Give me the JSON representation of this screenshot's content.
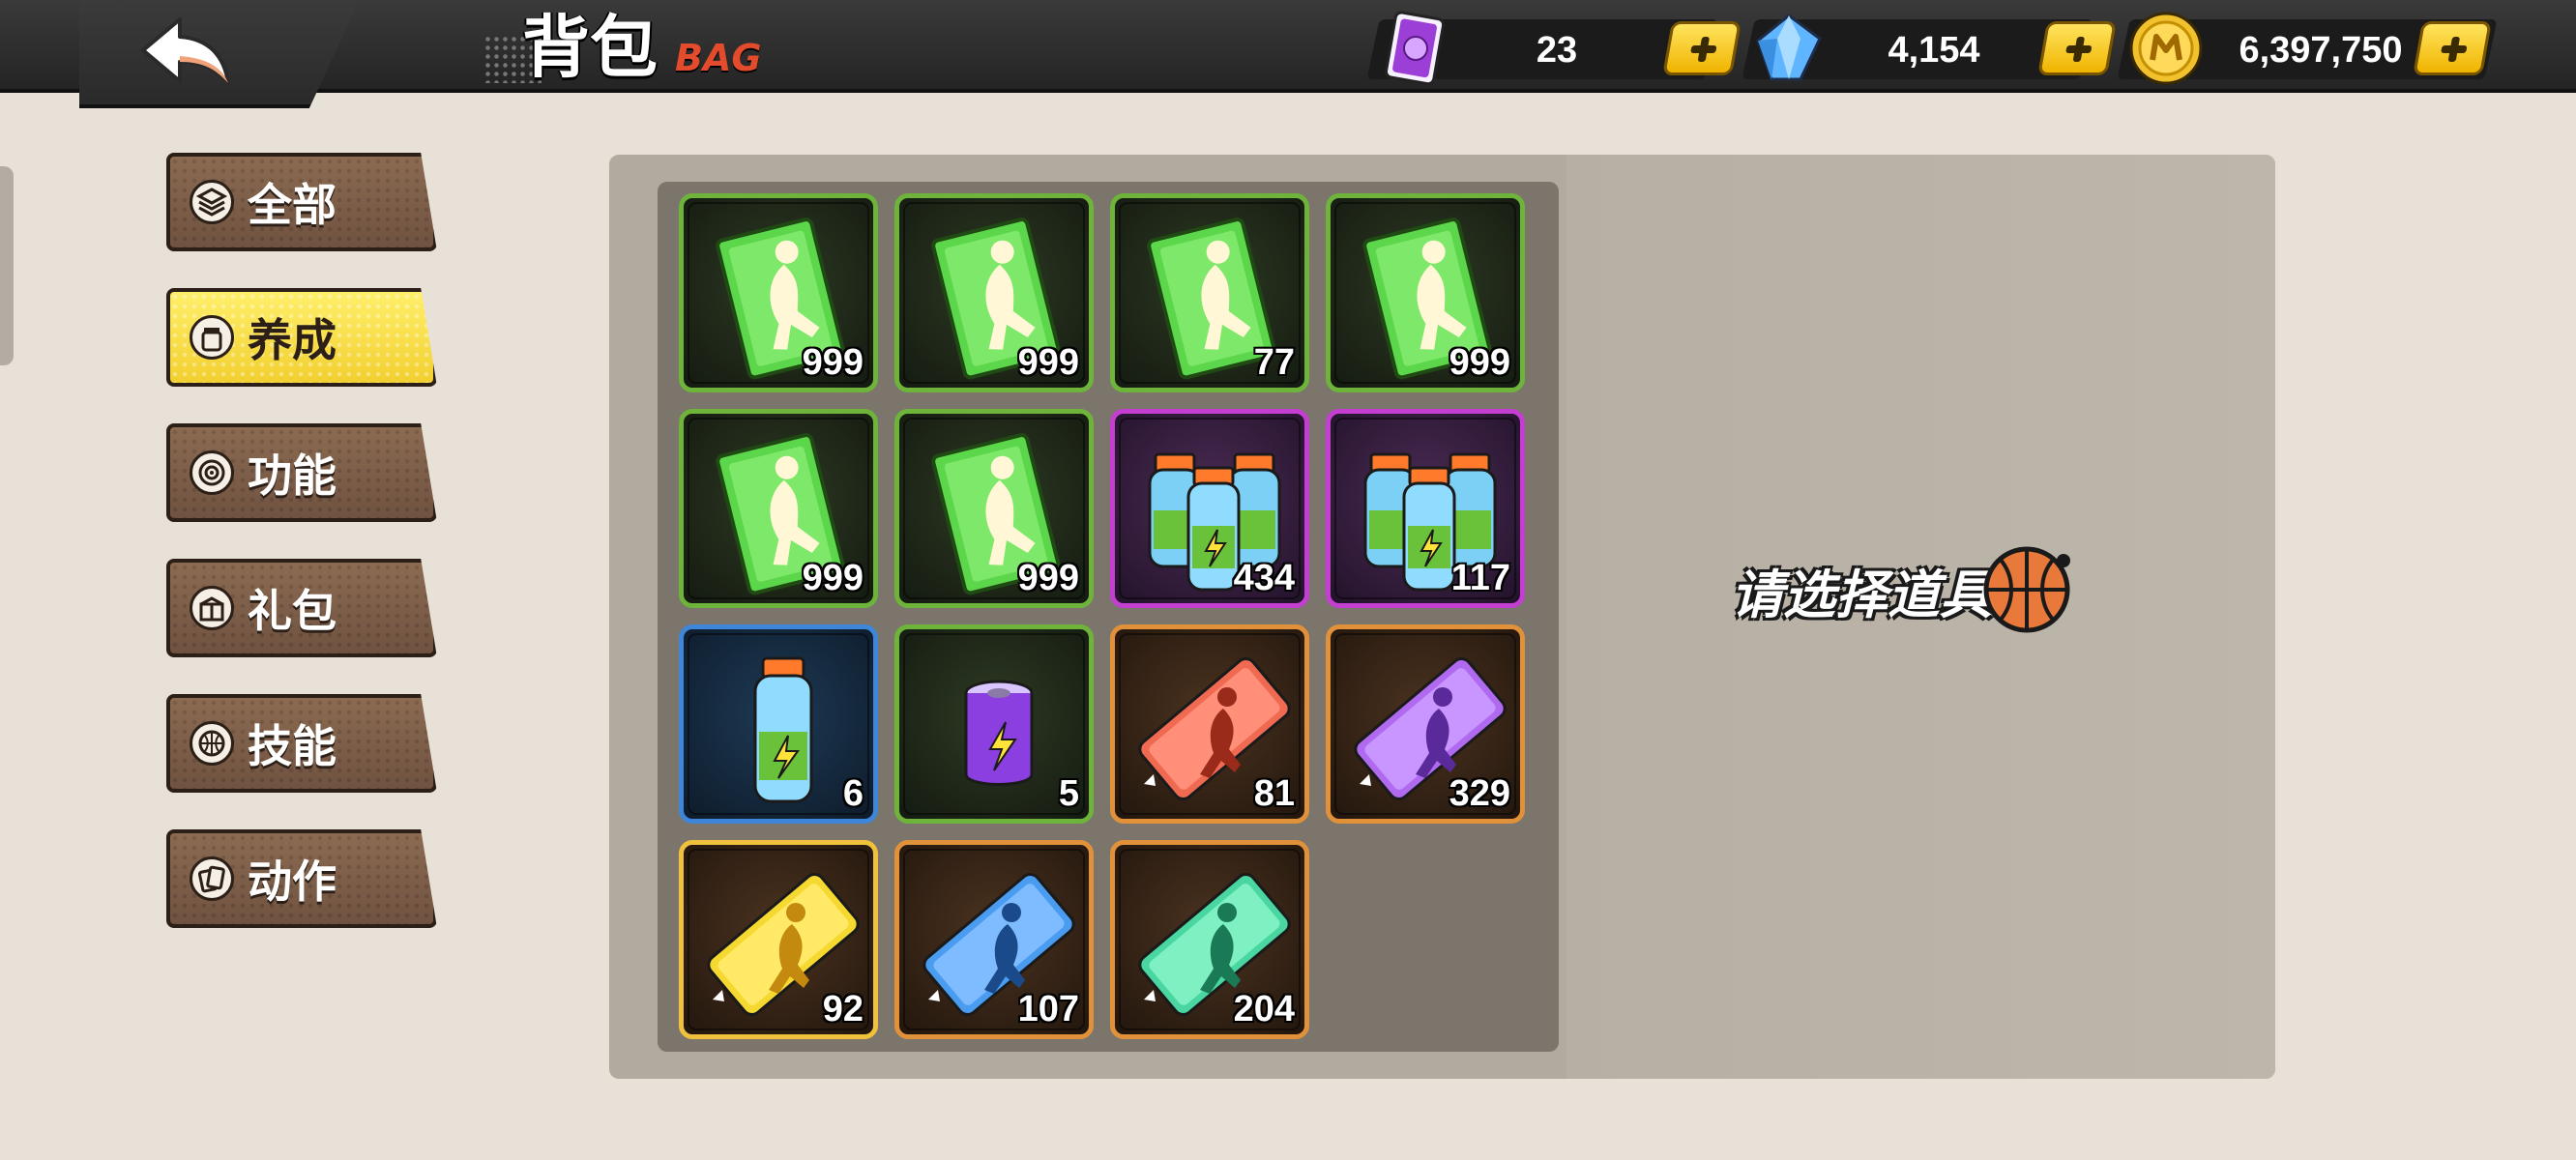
{
  "header": {
    "title_cn": "背包",
    "title_en": "BAG"
  },
  "currencies": [
    {
      "name": "card",
      "icon": "purple-card-icon",
      "value": "23"
    },
    {
      "name": "diamond",
      "icon": "diamond-icon",
      "value": "4,154"
    },
    {
      "name": "coin",
      "icon": "gold-coin-icon",
      "value": "6,397,750"
    }
  ],
  "tabs": [
    {
      "label": "全部",
      "icon": "layers-icon",
      "active": false
    },
    {
      "label": "养成",
      "icon": "jar-icon",
      "active": true
    },
    {
      "label": "功能",
      "icon": "target-icon",
      "active": false
    },
    {
      "label": "礼包",
      "icon": "gift-icon",
      "active": false
    },
    {
      "label": "技能",
      "icon": "basketball-icon",
      "active": false
    },
    {
      "label": "动作",
      "icon": "cards-icon",
      "active": false
    }
  ],
  "items": [
    {
      "qty": "999",
      "kind": "green-dunk-card-icon",
      "rarity": "green"
    },
    {
      "qty": "999",
      "kind": "green-dunk-card-icon",
      "rarity": "green"
    },
    {
      "qty": "77",
      "kind": "green-dunk-card-icon",
      "rarity": "green"
    },
    {
      "qty": "999",
      "kind": "green-dunk-card-icon",
      "rarity": "green"
    },
    {
      "qty": "999",
      "kind": "green-dunk-card-icon",
      "rarity": "green"
    },
    {
      "qty": "999",
      "kind": "green-dunk-card-icon",
      "rarity": "green"
    },
    {
      "qty": "434",
      "kind": "energy-drink-pack-icon",
      "rarity": "purple"
    },
    {
      "qty": "117",
      "kind": "energy-drink-pack-icon",
      "rarity": "purple"
    },
    {
      "qty": "6",
      "kind": "energy-drink-bottle-icon",
      "rarity": "blue"
    },
    {
      "qty": "5",
      "kind": "energy-can-icon",
      "rarity": "green"
    },
    {
      "qty": "81",
      "kind": "red-player-ticket-icon",
      "rarity": "orange"
    },
    {
      "qty": "329",
      "kind": "purple-player-ticket-icon",
      "rarity": "orange"
    },
    {
      "qty": "92",
      "kind": "yellow-player-ticket-icon",
      "rarity": "gold"
    },
    {
      "qty": "107",
      "kind": "blue-player-ticket-icon",
      "rarity": "orange"
    },
    {
      "qty": "204",
      "kind": "teal-player-ticket-icon",
      "rarity": "orange"
    }
  ],
  "detail": {
    "hint": "请选择道具"
  },
  "colors": {
    "accent_yellow": "#f2cf2f",
    "tab_brown": "#7a5c47",
    "bag_red": "#e24b2c"
  }
}
